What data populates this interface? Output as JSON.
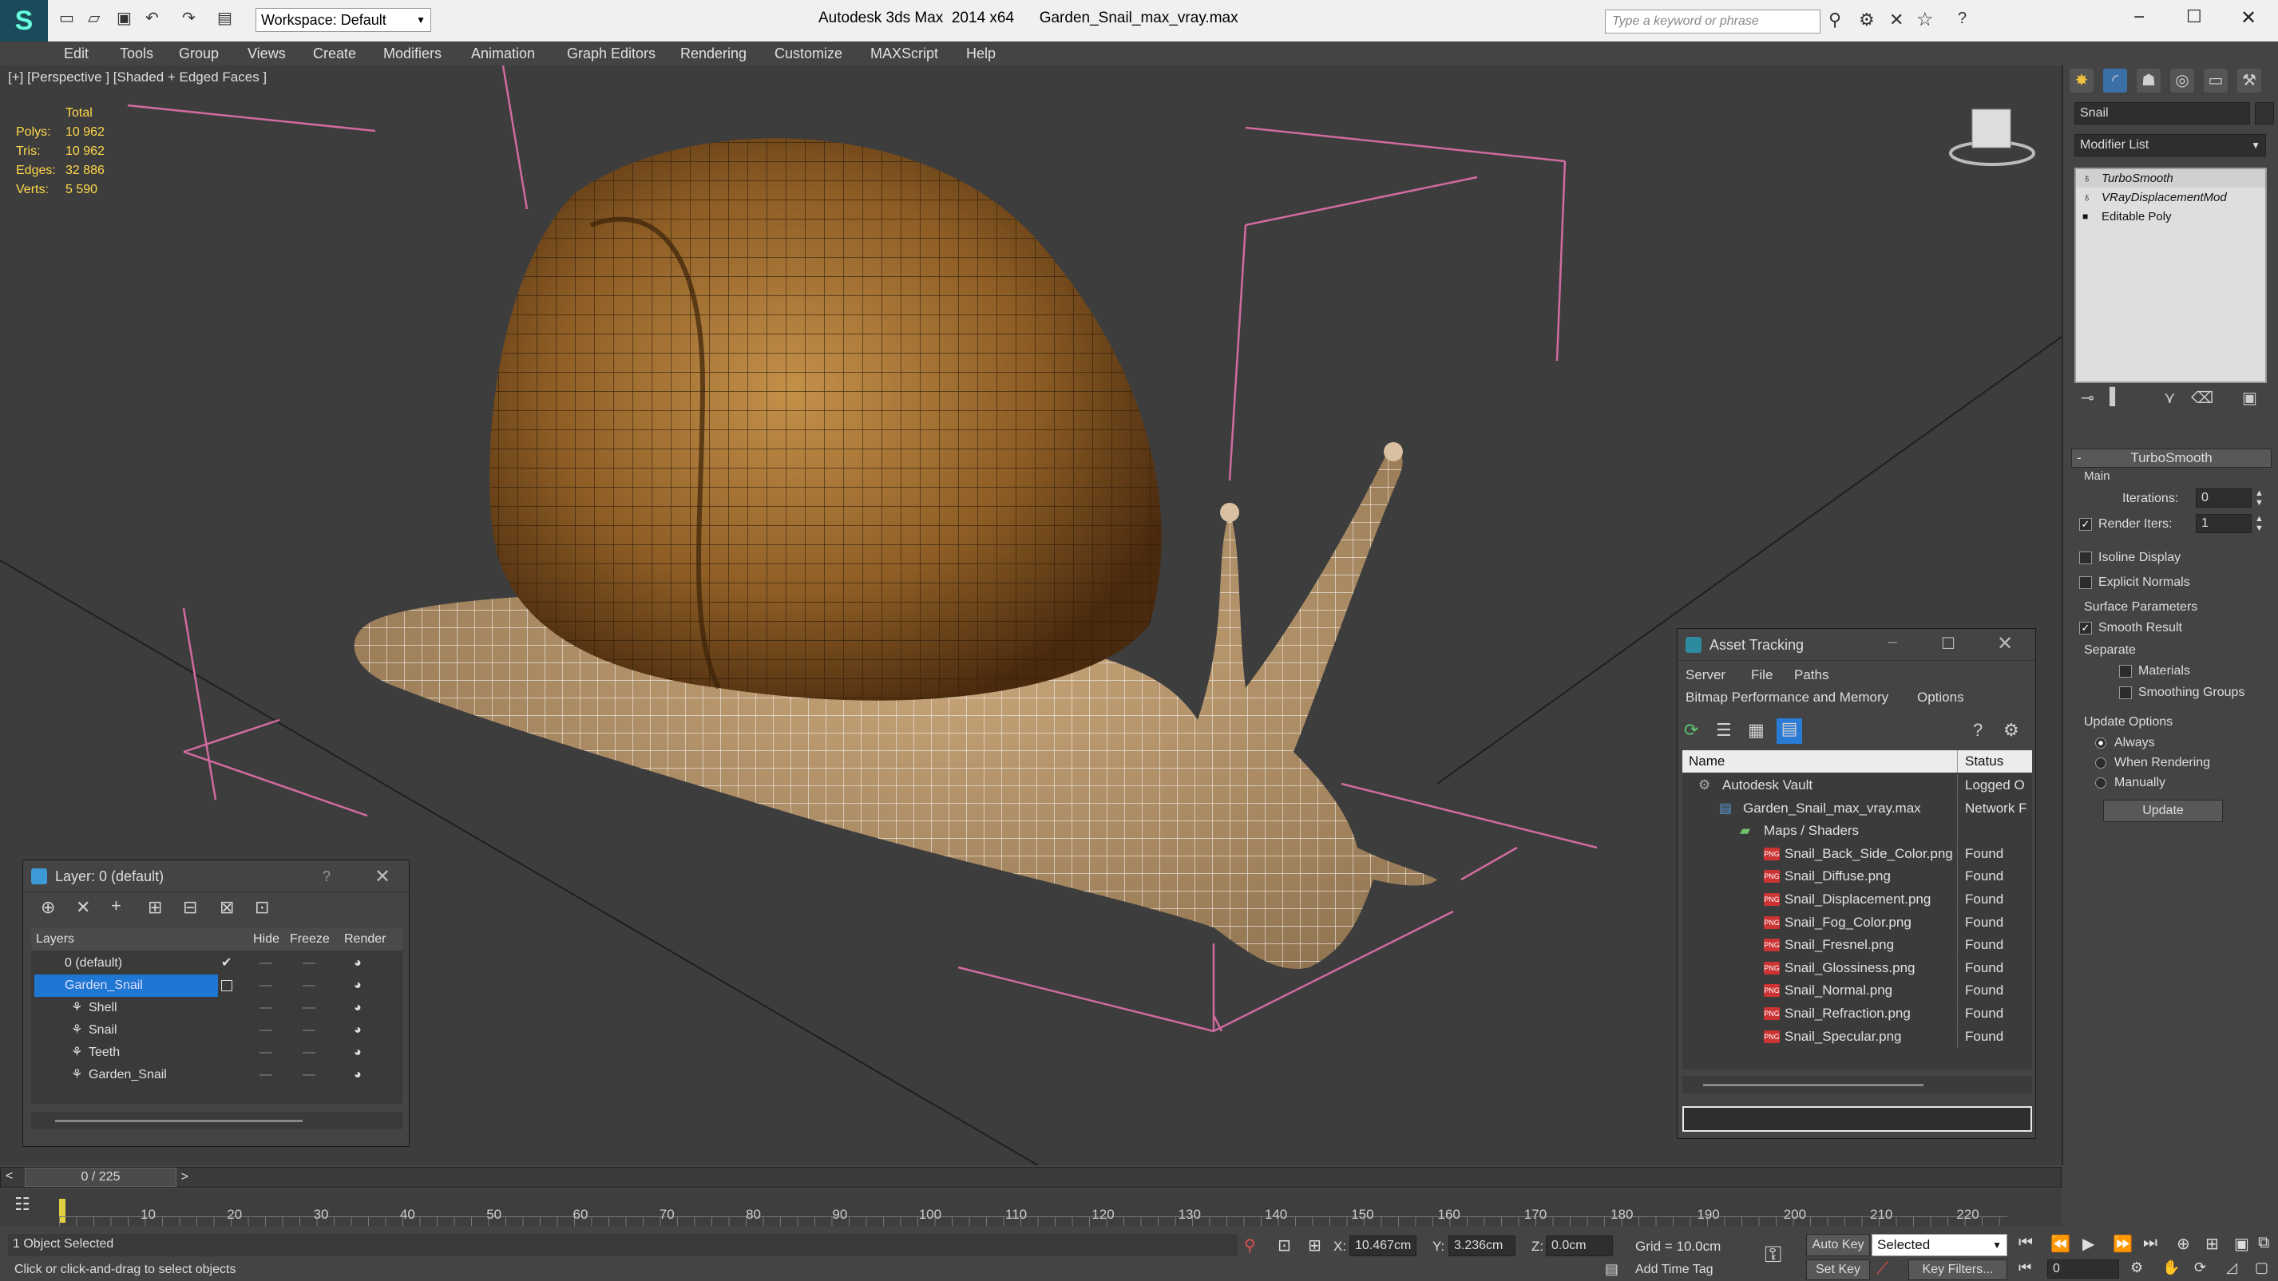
{
  "window": {
    "workspace": "Workspace: Default",
    "title": "Autodesk 3ds Max  2014 x64      Garden_Snail_max_vray.max",
    "search_placeholder": "Type a keyword or phrase"
  },
  "menu": [
    "Edit",
    "Tools",
    "Group",
    "Views",
    "Create",
    "Modifiers",
    "Animation",
    "Graph Editors",
    "Rendering",
    "Customize",
    "MAXScript",
    "Help"
  ],
  "viewport": {
    "label": "[+] [Perspective ] [Shaded + Edged Faces ]",
    "stats": {
      "header": "Total",
      "rows": [
        {
          "label": "Polys:",
          "value": "10 962"
        },
        {
          "label": "Tris:",
          "value": "10 962"
        },
        {
          "label": "Edges:",
          "value": "32 886"
        },
        {
          "label": "Verts:",
          "value": "5 590"
        }
      ]
    }
  },
  "command_panel": {
    "object_name": "Snail",
    "modifier_list": "Modifier List",
    "stack": [
      "TurboSmooth",
      "VRayDisplacementMod",
      "Editable Poly"
    ],
    "rollout": "TurboSmooth",
    "main": "Main",
    "iterations_label": "Iterations:",
    "iterations_value": "0",
    "render_iters_label": "Render Iters:",
    "render_iters_value": "1",
    "isoline": "Isoline Display",
    "explicit": "Explicit Normals",
    "surface_params": "Surface Parameters",
    "smooth_result": "Smooth Result",
    "separate": "Separate",
    "materials": "Materials",
    "smoothing_groups": "Smoothing Groups",
    "update_options": "Update Options",
    "always": "Always",
    "when_rendering": "When Rendering",
    "manually": "Manually",
    "update_button": "Update"
  },
  "layer_window": {
    "title": "Layer: 0 (default)",
    "help": "?",
    "columns": [
      "Layers",
      "Hide",
      "Freeze",
      "Render"
    ],
    "rows": [
      {
        "name": "0 (default)",
        "indent": 0
      },
      {
        "name": "Garden_Snail",
        "indent": 0
      },
      {
        "name": "Shell",
        "indent": 1
      },
      {
        "name": "Snail",
        "indent": 1
      },
      {
        "name": "Teeth",
        "indent": 1
      },
      {
        "name": "Garden_Snail",
        "indent": 1
      }
    ]
  },
  "asset_window": {
    "title": "Asset Tracking",
    "menu": [
      "Server",
      "File",
      "Paths"
    ],
    "menu2": [
      "Bitmap Performance and Memory",
      "Options"
    ],
    "columns": [
      "Name",
      "Status"
    ],
    "rows": [
      {
        "name": "Autodesk Vault",
        "status": "Logged O",
        "indent": 0
      },
      {
        "name": "Garden_Snail_max_vray.max",
        "status": "Network F",
        "indent": 1
      },
      {
        "name": "Maps / Shaders",
        "status": "",
        "indent": 2
      },
      {
        "name": "Snail_Back_Side_Color.png",
        "status": "Found",
        "indent": 3
      },
      {
        "name": "Snail_Diffuse.png",
        "status": "Found",
        "indent": 3
      },
      {
        "name": "Snail_Displacement.png",
        "status": "Found",
        "indent": 3
      },
      {
        "name": "Snail_Fog_Color.png",
        "status": "Found",
        "indent": 3
      },
      {
        "name": "Snail_Fresnel.png",
        "status": "Found",
        "indent": 3
      },
      {
        "name": "Snail_Glossiness.png",
        "status": "Found",
        "indent": 3
      },
      {
        "name": "Snail_Normal.png",
        "status": "Found",
        "indent": 3
      },
      {
        "name": "Snail_Refraction.png",
        "status": "Found",
        "indent": 3
      },
      {
        "name": "Snail_Specular.png",
        "status": "Found",
        "indent": 3
      }
    ],
    "png": "PNG"
  },
  "timeline": {
    "frame": "0 / 225",
    "ticks": [
      "10",
      "20",
      "30",
      "40",
      "50",
      "60",
      "70",
      "80",
      "90",
      "100",
      "110",
      "120",
      "130",
      "140",
      "150",
      "160",
      "170",
      "180",
      "190",
      "200",
      "210",
      "220"
    ]
  },
  "status": {
    "selected": "1 Object Selected",
    "hint": "Click or click-and-drag to select objects",
    "x_label": "X:",
    "x_value": "10.467cm",
    "y_label": "Y:",
    "y_value": "3.236cm",
    "z_label": "Z:",
    "z_value": "0.0cm",
    "grid": "Grid = 10.0cm",
    "auto_key": "Auto Key",
    "selected_dropdown": "Selected",
    "set_key": "Set Key",
    "key_filters": "Key Filters...",
    "add_time_tag": "Add Time Tag",
    "frame_field": "0"
  }
}
